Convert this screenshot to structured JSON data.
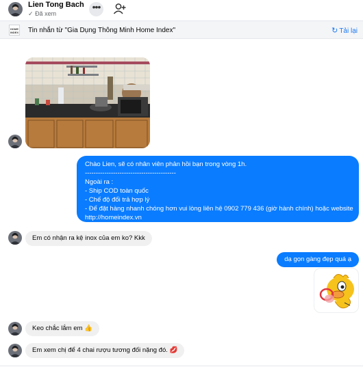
{
  "header": {
    "name": "Lien Tong Bach",
    "status": "Đã xem",
    "check": "✓"
  },
  "banner": {
    "text": "Tin nhắn từ  \"Gia Dụng Thông Minh Home Index\"",
    "reload_label": "Tải lại",
    "logo_text": "HOME INDEX"
  },
  "messages": {
    "long_reply": {
      "line1": "Chào Lien, sẽ có nhân viên phản hồi bạn trong vòng 1h.",
      "line2": "------------------------------------------",
      "line3": "Ngoài ra :",
      "line4": "- Ship COD toàn quốc",
      "line5": "- Chế độ đổi trả hợp lý",
      "line6": "- Để đặt hàng nhanh chóng hơn vui lòng liên hệ 0902 779 436 (giờ hành chính) hoặc website",
      "line7": "http://homeindex.vn"
    },
    "in1": "Em có nhận ra kệ inox của em ko? Kkk",
    "out1": "dạ gọn gàng đẹp quá ạ",
    "in2": "Keo chắc lắm em 👍",
    "in3": "Em xem chị để 4 chai rượu tương đối nặng đó. 💋"
  },
  "colors": {
    "accent": "#0a7cff",
    "incoming": "#f0f0f0",
    "link": "#1877f2"
  }
}
